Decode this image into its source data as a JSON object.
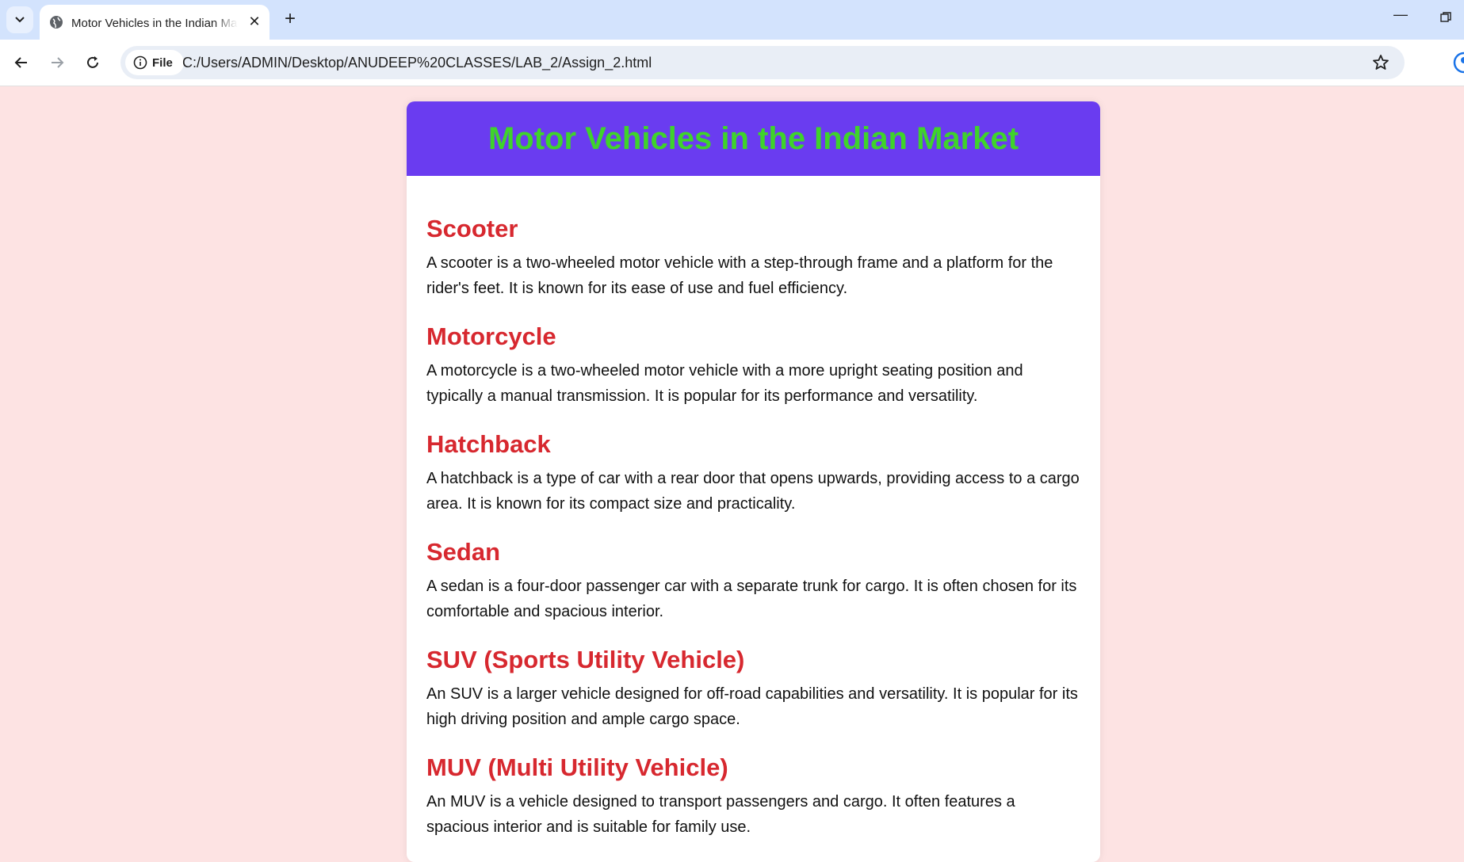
{
  "browser": {
    "tab_title": "Motor Vehicles in the Indian Market",
    "file_label": "File",
    "url": "C:/Users/ADMIN/Desktop/ANUDEEP%20CLASSES/LAB_2/Assign_2.html"
  },
  "page": {
    "heading": "Motor Vehicles in the Indian Market",
    "items": [
      {
        "title": "Scooter",
        "text": "A scooter is a two-wheeled motor vehicle with a step-through frame and a platform for the rider's feet. It is known for its ease of use and fuel efficiency."
      },
      {
        "title": "Motorcycle",
        "text": "A motorcycle is a two-wheeled motor vehicle with a more upright seating position and typically a manual transmission. It is popular for its performance and versatility."
      },
      {
        "title": "Hatchback",
        "text": "A hatchback is a type of car with a rear door that opens upwards, providing access to a cargo area. It is known for its compact size and practicality."
      },
      {
        "title": "Sedan",
        "text": "A sedan is a four-door passenger car with a separate trunk for cargo. It is often chosen for its comfortable and spacious interior."
      },
      {
        "title": "SUV (Sports Utility Vehicle)",
        "text": "An SUV is a larger vehicle designed for off-road capabilities and versatility. It is popular for its high driving position and ample cargo space."
      },
      {
        "title": "MUV (Multi Utility Vehicle)",
        "text": "An MUV is a vehicle designed to transport passengers and cargo. It often features a spacious interior and is suitable for family use."
      }
    ]
  },
  "colors": {
    "page_background": "#fde3e3",
    "header_background": "#6a3cf0",
    "header_text": "#3fd32b",
    "item_title": "#d7282f"
  }
}
